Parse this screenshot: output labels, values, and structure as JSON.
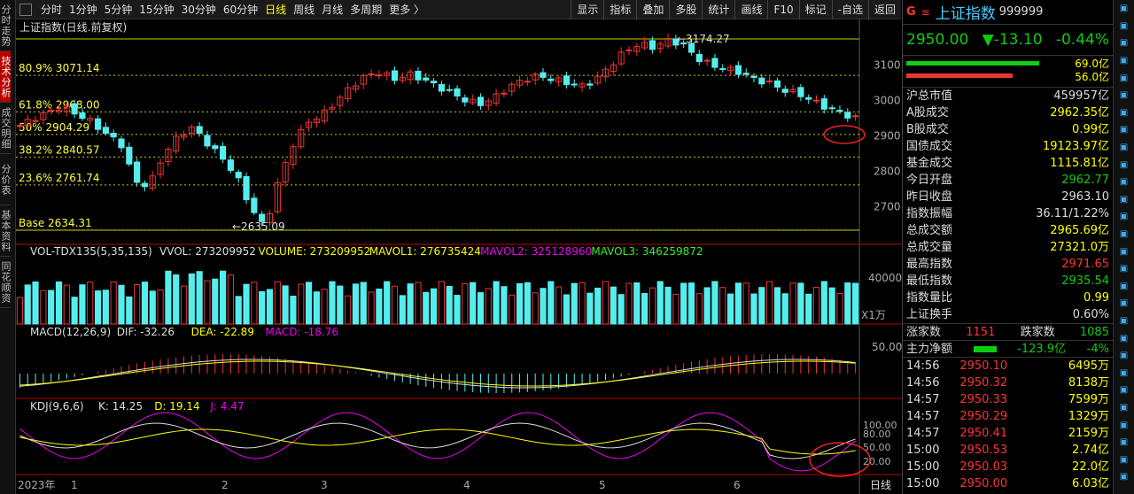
{
  "nav": {
    "tabs": [
      "分时走势",
      "技术分析",
      "成交明细",
      "分价表",
      "基本资料",
      "同花顺资"
    ]
  },
  "toolbar": {
    "periods": [
      "分时",
      "1分钟",
      "5分钟",
      "15分钟",
      "30分钟",
      "60分钟",
      "日线",
      "周线",
      "月线",
      "多周期",
      "更多 〉"
    ],
    "selected": "日线",
    "tools": [
      "显示",
      "指标",
      "叠加",
      "多股",
      "统计",
      "画线",
      "F10",
      "标记",
      "-自选",
      "返回"
    ]
  },
  "main": {
    "title": "上证指数(日线.前复权)",
    "fib": [
      {
        "label": "80.9% 3071.14",
        "v": 3071.14
      },
      {
        "label": "61.8% 2968.00",
        "v": 2968.0
      },
      {
        "label": "50% 2904.29",
        "v": 2904.29
      },
      {
        "label": "38.2% 2840.57",
        "v": 2840.57
      },
      {
        "label": "23.6% 2761.74",
        "v": 2761.74
      },
      {
        "label": "Base 2634.31",
        "v": 2634.31
      }
    ],
    "high_label": "3174.27",
    "low_label": "2635.09",
    "yticks": [
      "3100",
      "3000",
      "2900",
      "2800",
      "2700"
    ]
  },
  "vol": {
    "legend": [
      {
        "t": "VOL-TDX135(5,35,135)",
        "c": "#ddd"
      },
      {
        "t": "VVOL: 273209952",
        "c": "#ddd"
      },
      {
        "t": "VOLUME: 273209952",
        "c": "#ff0"
      },
      {
        "t": "MAVOL1: 276735424",
        "c": "#ff0"
      },
      {
        "t": "MAVOL2: 325128960",
        "c": "#e0e"
      },
      {
        "t": "MAVOL3: 346259872",
        "c": "#3e3"
      }
    ],
    "ytick": "40000",
    "unit": "X1万"
  },
  "macd": {
    "legend": [
      {
        "t": "MACD(12,26,9)",
        "c": "#ddd"
      },
      {
        "t": "DIF: -32.26",
        "c": "#ddd"
      },
      {
        "t": "DEA: -22.89",
        "c": "#ff0"
      },
      {
        "t": "MACD: -18.76",
        "c": "#e0e"
      }
    ],
    "ytick": "50.00"
  },
  "kdj": {
    "legend": [
      {
        "t": "KDJ(9,6,6)",
        "c": "#ddd"
      },
      {
        "t": "K: 14.25",
        "c": "#ddd"
      },
      {
        "t": "D: 19.14",
        "c": "#ff0"
      },
      {
        "t": "J: 4.47",
        "c": "#e0e"
      }
    ],
    "yticks": [
      "100.00",
      "80.00",
      "50.00",
      "20.00"
    ]
  },
  "xaxis": {
    "labels": [
      "2023年",
      "1",
      "2",
      "3",
      "4",
      "5",
      "6"
    ],
    "period": "日线"
  },
  "quote": {
    "name": "上证指数",
    "code": "999999",
    "price": "2950.00",
    "change": "▼-13.10",
    "pct": "-0.44%",
    "bar_up": "69.0亿",
    "bar_dn": "56.0亿",
    "fields": [
      [
        "沪总市值",
        "459957亿",
        "wht"
      ],
      [
        "A股成交",
        "2962.35亿",
        "yel"
      ],
      [
        "B股成交",
        "0.99亿",
        "yel"
      ],
      [
        "国债成交",
        "19123.97亿",
        "yel"
      ],
      [
        "基金成交",
        "1115.81亿",
        "yel"
      ],
      [
        "今日开盘",
        "2962.77",
        "grn"
      ],
      [
        "昨日收盘",
        "2963.10",
        "wht"
      ],
      [
        "指数振幅",
        "36.11/1.22%",
        "wht"
      ],
      [
        "总成交额",
        "2965.69亿",
        "yel"
      ],
      [
        "总成交量",
        "27321.0万",
        "yel"
      ],
      [
        "最高指数",
        "2971.65",
        "red"
      ],
      [
        "最低指数",
        "2935.54",
        "grn"
      ],
      [
        "指数量比",
        "0.99",
        "yel"
      ],
      [
        "上证换手",
        "0.60%",
        "wht"
      ]
    ],
    "zhang_label": "涨家数",
    "zhang": "1151",
    "die_label": "跌家数",
    "die": "1085",
    "flow_label": "主力净额",
    "flow": "-123.9亿",
    "flow_pct": "-4%",
    "ticks": [
      [
        "14:56",
        "2950.10",
        "6495万"
      ],
      [
        "14:56",
        "2950.32",
        "8138万"
      ],
      [
        "14:57",
        "2950.33",
        "7599万"
      ],
      [
        "14:57",
        "2950.29",
        "1329万"
      ],
      [
        "14:57",
        "2950.41",
        "2159万"
      ],
      [
        "15:00",
        "2950.53",
        "2.74亿"
      ],
      [
        "15:00",
        "2950.03",
        "22.0亿"
      ],
      [
        "15:00",
        "2950.00",
        "6.03亿"
      ]
    ]
  },
  "colors": {
    "up": "#e33",
    "down": "#5ee",
    "fib": "#c9c900"
  }
}
